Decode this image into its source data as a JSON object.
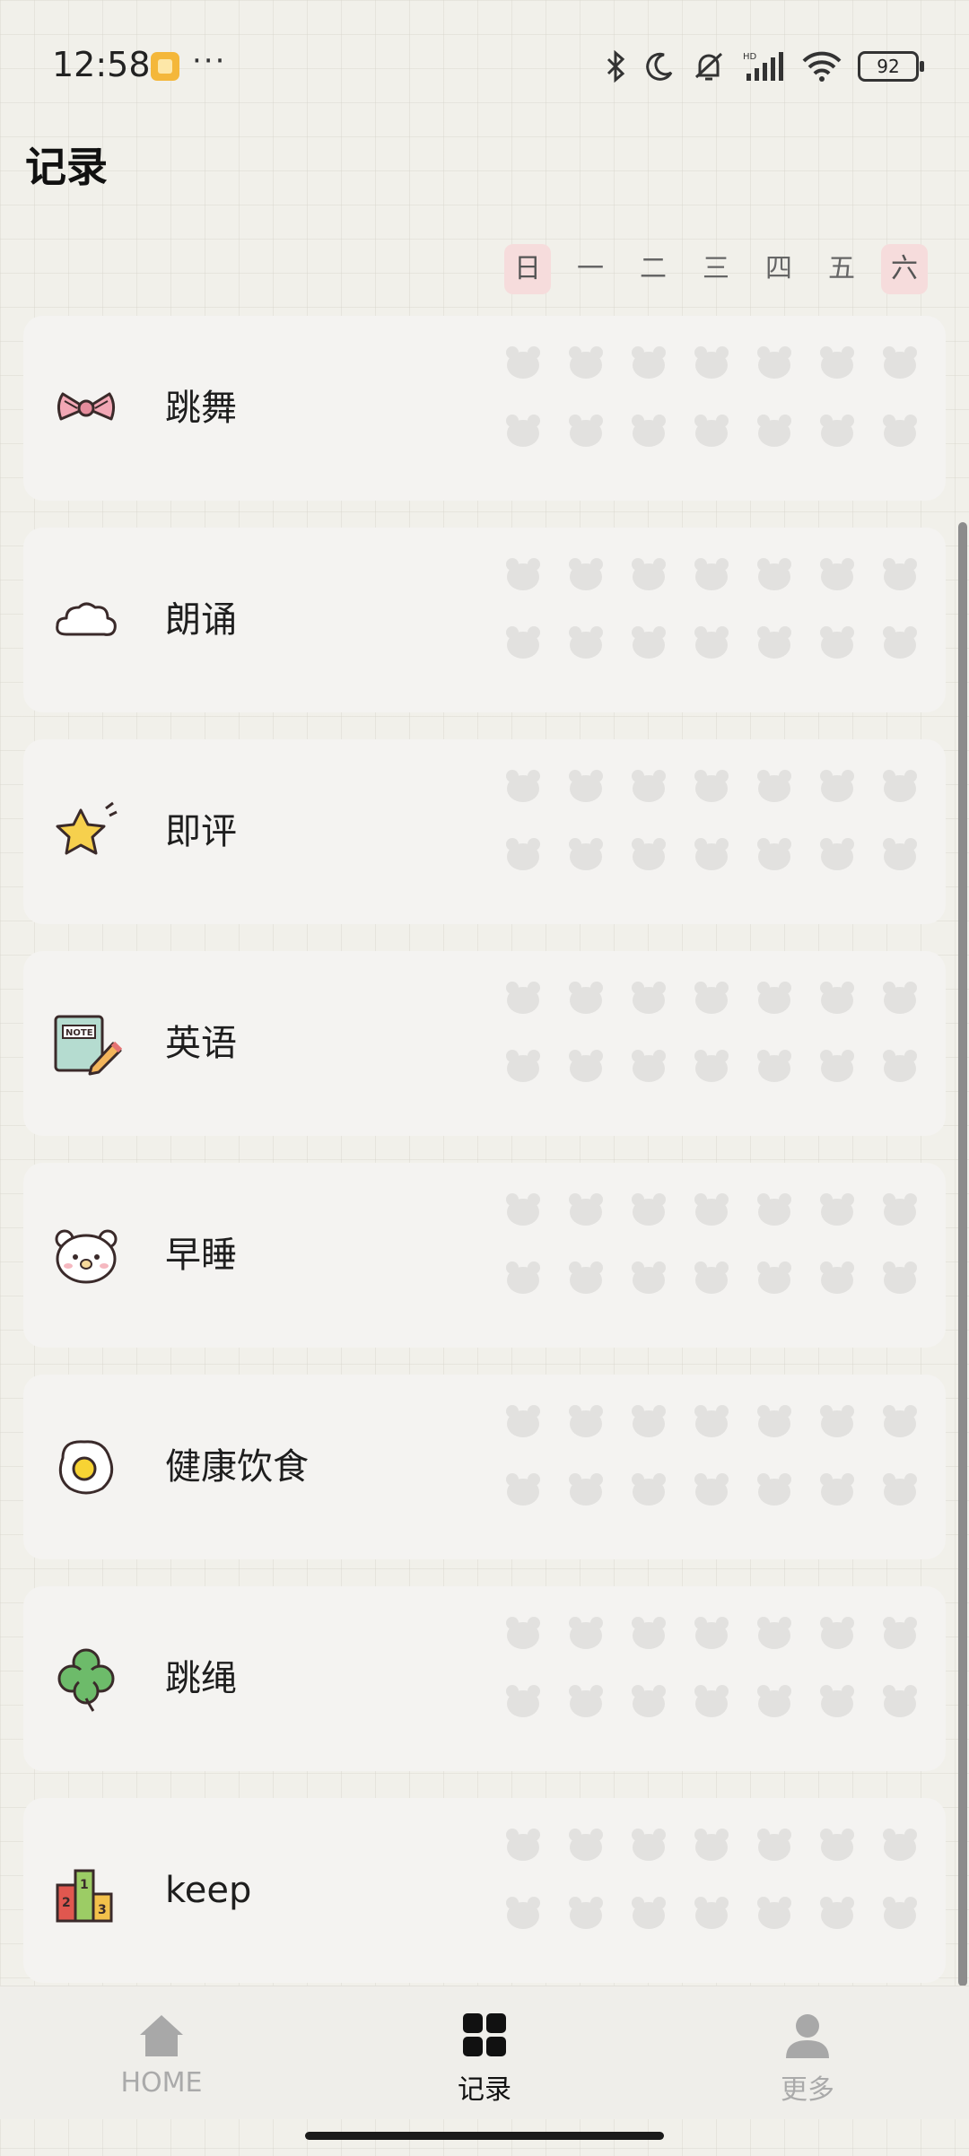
{
  "status_bar": {
    "time": "12:58",
    "more": "···",
    "battery": "92",
    "icons": [
      "notification-app-icon",
      "bluetooth-icon",
      "moon-icon",
      "mute-icon",
      "signal-hd-icon",
      "wifi-icon",
      "battery-icon"
    ]
  },
  "page": {
    "title": "记录"
  },
  "week_days": [
    "日",
    "一",
    "二",
    "三",
    "四",
    "五",
    "六"
  ],
  "highlighted_days": [
    "日",
    "六"
  ],
  "habits": [
    {
      "label": "跳舞",
      "icon": "bow-icon"
    },
    {
      "label": "朗诵",
      "icon": "cloud-icon"
    },
    {
      "label": "即评",
      "icon": "star-icon"
    },
    {
      "label": "英语",
      "icon": "notebook-pencil-icon"
    },
    {
      "label": "早睡",
      "icon": "bear-face-icon"
    },
    {
      "label": "健康饮食",
      "icon": "fried-egg-icon"
    },
    {
      "label": "跳绳",
      "icon": "clover-icon"
    },
    {
      "label": "keep",
      "icon": "podium-icon"
    }
  ],
  "podium_numbers": [
    "2",
    "1",
    "3"
  ],
  "note_label": "NOTE",
  "bottom_nav": [
    {
      "label": "HOME",
      "icon": "home-icon",
      "active": false
    },
    {
      "label": "记录",
      "icon": "grid-icon",
      "active": true
    },
    {
      "label": "更多",
      "icon": "person-icon",
      "active": false
    }
  ],
  "colors": {
    "background": "#f1f0ea",
    "card": "#f4f3f1",
    "day_highlight": "#f6dcdc",
    "bear_placeholder": "#e2e1df",
    "nav_active": "#111111",
    "nav_inactive": "#aaaaaa"
  }
}
